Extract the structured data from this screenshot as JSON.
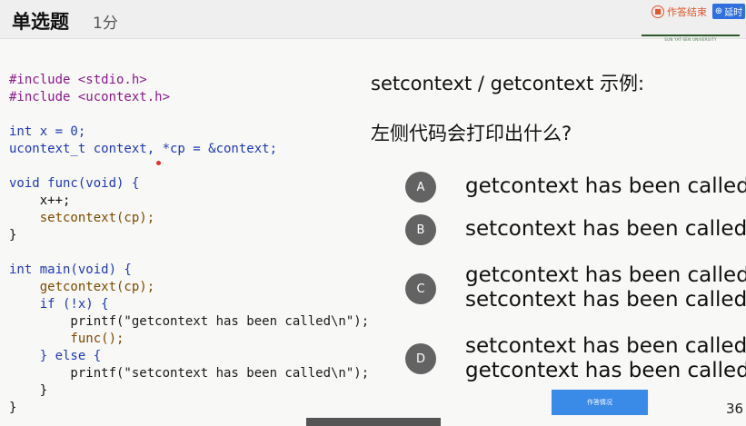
{
  "header": {
    "title": "单选题",
    "score": "1分",
    "end_label": "作答结束",
    "delay_label": "延时",
    "logo_text": "SUN YAT-SEN UNIVERSITY"
  },
  "code": {
    "lines": [
      "#include <stdio.h>",
      "#include <ucontext.h>",
      "",
      "int x = 0;",
      "ucontext_t context, *cp = &context;",
      "",
      "void func(void) {",
      "    x++;",
      "    setcontext(cp);",
      "}",
      "",
      "int main(void) {",
      "    getcontext(cp);",
      "    if (!x) {",
      "        printf(\"getcontext has been called\\n\");",
      "        func();",
      "    } else {",
      "        printf(\"setcontext has been called\\n\");",
      "    }",
      "}"
    ]
  },
  "question": {
    "heading": "setcontext / getcontext 示例:",
    "prompt": "左侧代码会打印出什么?"
  },
  "options": [
    {
      "key": "A",
      "lines": [
        "getcontext has been called"
      ]
    },
    {
      "key": "B",
      "lines": [
        "setcontext has been called"
      ]
    },
    {
      "key": "C",
      "lines": [
        "getcontext has been called",
        "setcontext has been called"
      ]
    },
    {
      "key": "D",
      "lines": [
        "setcontext has been called",
        "getcontext has been called"
      ]
    }
  ],
  "footer": {
    "submit_label": "作答情况",
    "page_number": "36"
  },
  "colors": {
    "option_circle": "#636363",
    "submit_button": "#3a8ae8",
    "delay_button": "#2f6fde",
    "end_accent": "#e0562a"
  },
  "icons": [
    "end-icon",
    "clock-icon",
    "cursor-dot"
  ]
}
